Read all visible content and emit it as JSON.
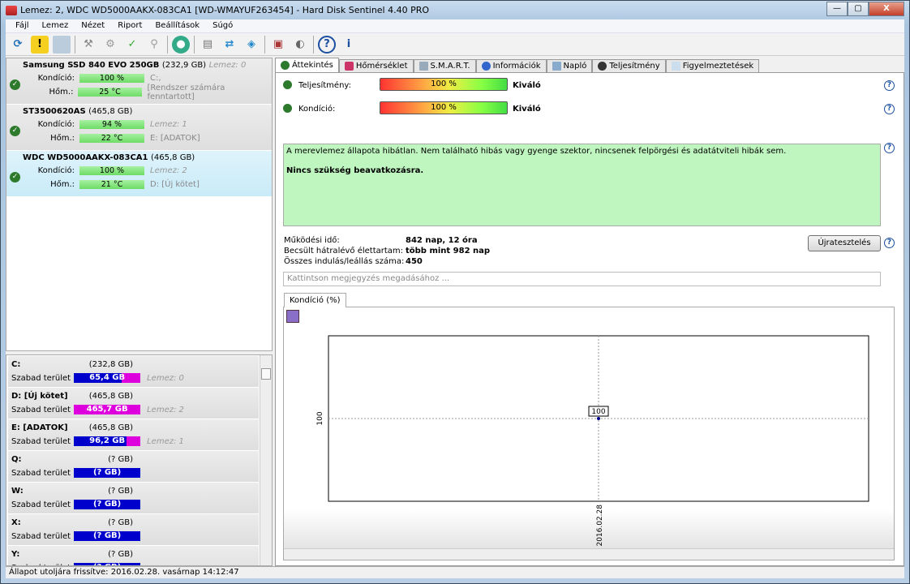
{
  "window": {
    "title": "Lemez: 2, WDC WD5000AAKX-083CA1 [WD-WMAYUF263454]  -  Hard Disk Sentinel 4.40 PRO",
    "minimize": "—",
    "maximize": "▢",
    "close": "X"
  },
  "menu": [
    "Fájl",
    "Lemez",
    "Nézet",
    "Riport",
    "Beállítások",
    "Súgó"
  ],
  "disks": [
    {
      "name": "Samsung SSD 840 EVO 250GB",
      "size": "(232,9 GB)",
      "disk_label": "Lemez: 0",
      "condition_label": "Kondíció:",
      "condition": "100 %",
      "temp_label": "Hőm.:",
      "temp": "25 °C",
      "partitions": "C:,",
      "note": "[Rendszer számára fenntartott]"
    },
    {
      "name": "ST3500620AS",
      "size": "(465,8 GB)",
      "disk_label": "",
      "condition_label": "Kondíció:",
      "condition": "94 %",
      "temp_label": "Hőm.:",
      "temp": "22 °C",
      "partitions": "Lemez: 1",
      "note": "E: [ADATOK]"
    },
    {
      "name": "WDC WD5000AAKX-083CA1",
      "size": "(465,8 GB)",
      "disk_label": "",
      "condition_label": "Kondíció:",
      "condition": "100 %",
      "temp_label": "Hőm.:",
      "temp": "21 °C",
      "partitions": "Lemez: 2",
      "note": "D: [Új kötet]"
    }
  ],
  "volumes": [
    {
      "name": "C:",
      "size": "(232,8 GB)",
      "free_label": "Szabad terület",
      "free": "65,4 GB",
      "disk": "Lemez: 0",
      "used_pct": 72
    },
    {
      "name": "D: [Új kötet]",
      "size": "(465,8 GB)",
      "free_label": "Szabad terület",
      "free": "465,7 GB",
      "disk": "Lemez: 2",
      "used_pct": 0
    },
    {
      "name": "E: [ADATOK]",
      "size": "(465,8 GB)",
      "free_label": "Szabad terület",
      "free": "96,2 GB",
      "disk": "Lemez: 1",
      "used_pct": 79
    },
    {
      "name": "Q:",
      "size": "(? GB)",
      "free_label": "Szabad terület",
      "free": "(? GB)",
      "disk": "",
      "used_pct": 100
    },
    {
      "name": "W:",
      "size": "(? GB)",
      "free_label": "Szabad terület",
      "free": "(? GB)",
      "disk": "",
      "used_pct": 100
    },
    {
      "name": "X:",
      "size": "(? GB)",
      "free_label": "Szabad terület",
      "free": "(? GB)",
      "disk": "",
      "used_pct": 100
    },
    {
      "name": "Y:",
      "size": "(? GB)",
      "free_label": "Szabad terület",
      "free": "(? GB)",
      "disk": "",
      "used_pct": 100
    }
  ],
  "tabs": [
    "Áttekintés",
    "Hőmérséklet",
    "S.M.A.R.T.",
    "Információk",
    "Napló",
    "Teljesítmény",
    "Figyelmeztetések"
  ],
  "overview": {
    "performance_label": "Teljesítmény:",
    "performance": "100 %",
    "performance_rating": "Kiváló",
    "condition_label": "Kondíció:",
    "condition": "100 %",
    "condition_rating": "Kiváló",
    "message": "A merevlemez állapota hibátlan. Nem található hibás vagy gyenge szektor, nincsenek felpörgési és adatátviteli hibák sem.",
    "message_bold": "Nincs szükség beavatkozásra.",
    "info": [
      {
        "k": "Működési idő:",
        "v": "842 nap, 12 óra"
      },
      {
        "k": "Becsült hátralévő élettartam:",
        "v": "több mint 982 nap"
      },
      {
        "k": "Összes indulás/leállás száma:",
        "v": "450"
      }
    ],
    "retest": "Újratesztelés",
    "note_placeholder": "Kattintson megjegyzés megadásához ..."
  },
  "chart_tab": "Kondíció  (%)",
  "chart_data": {
    "type": "line",
    "title": "",
    "x": [
      "2016.02.28"
    ],
    "values": [
      100
    ],
    "ylabel": "",
    "xlabel": "",
    "y_tick": "100",
    "x_tick": "2016.02.28",
    "point_label": "100",
    "grid": true
  },
  "status": "Állapot utoljára frissítve: 2016.02.28. vasárnap 14:12:47",
  "colors": {
    "ok": "#2d7a2d",
    "free": "#dd00dd",
    "used": "#0000cc",
    "message_bg": "#bff5bf"
  }
}
